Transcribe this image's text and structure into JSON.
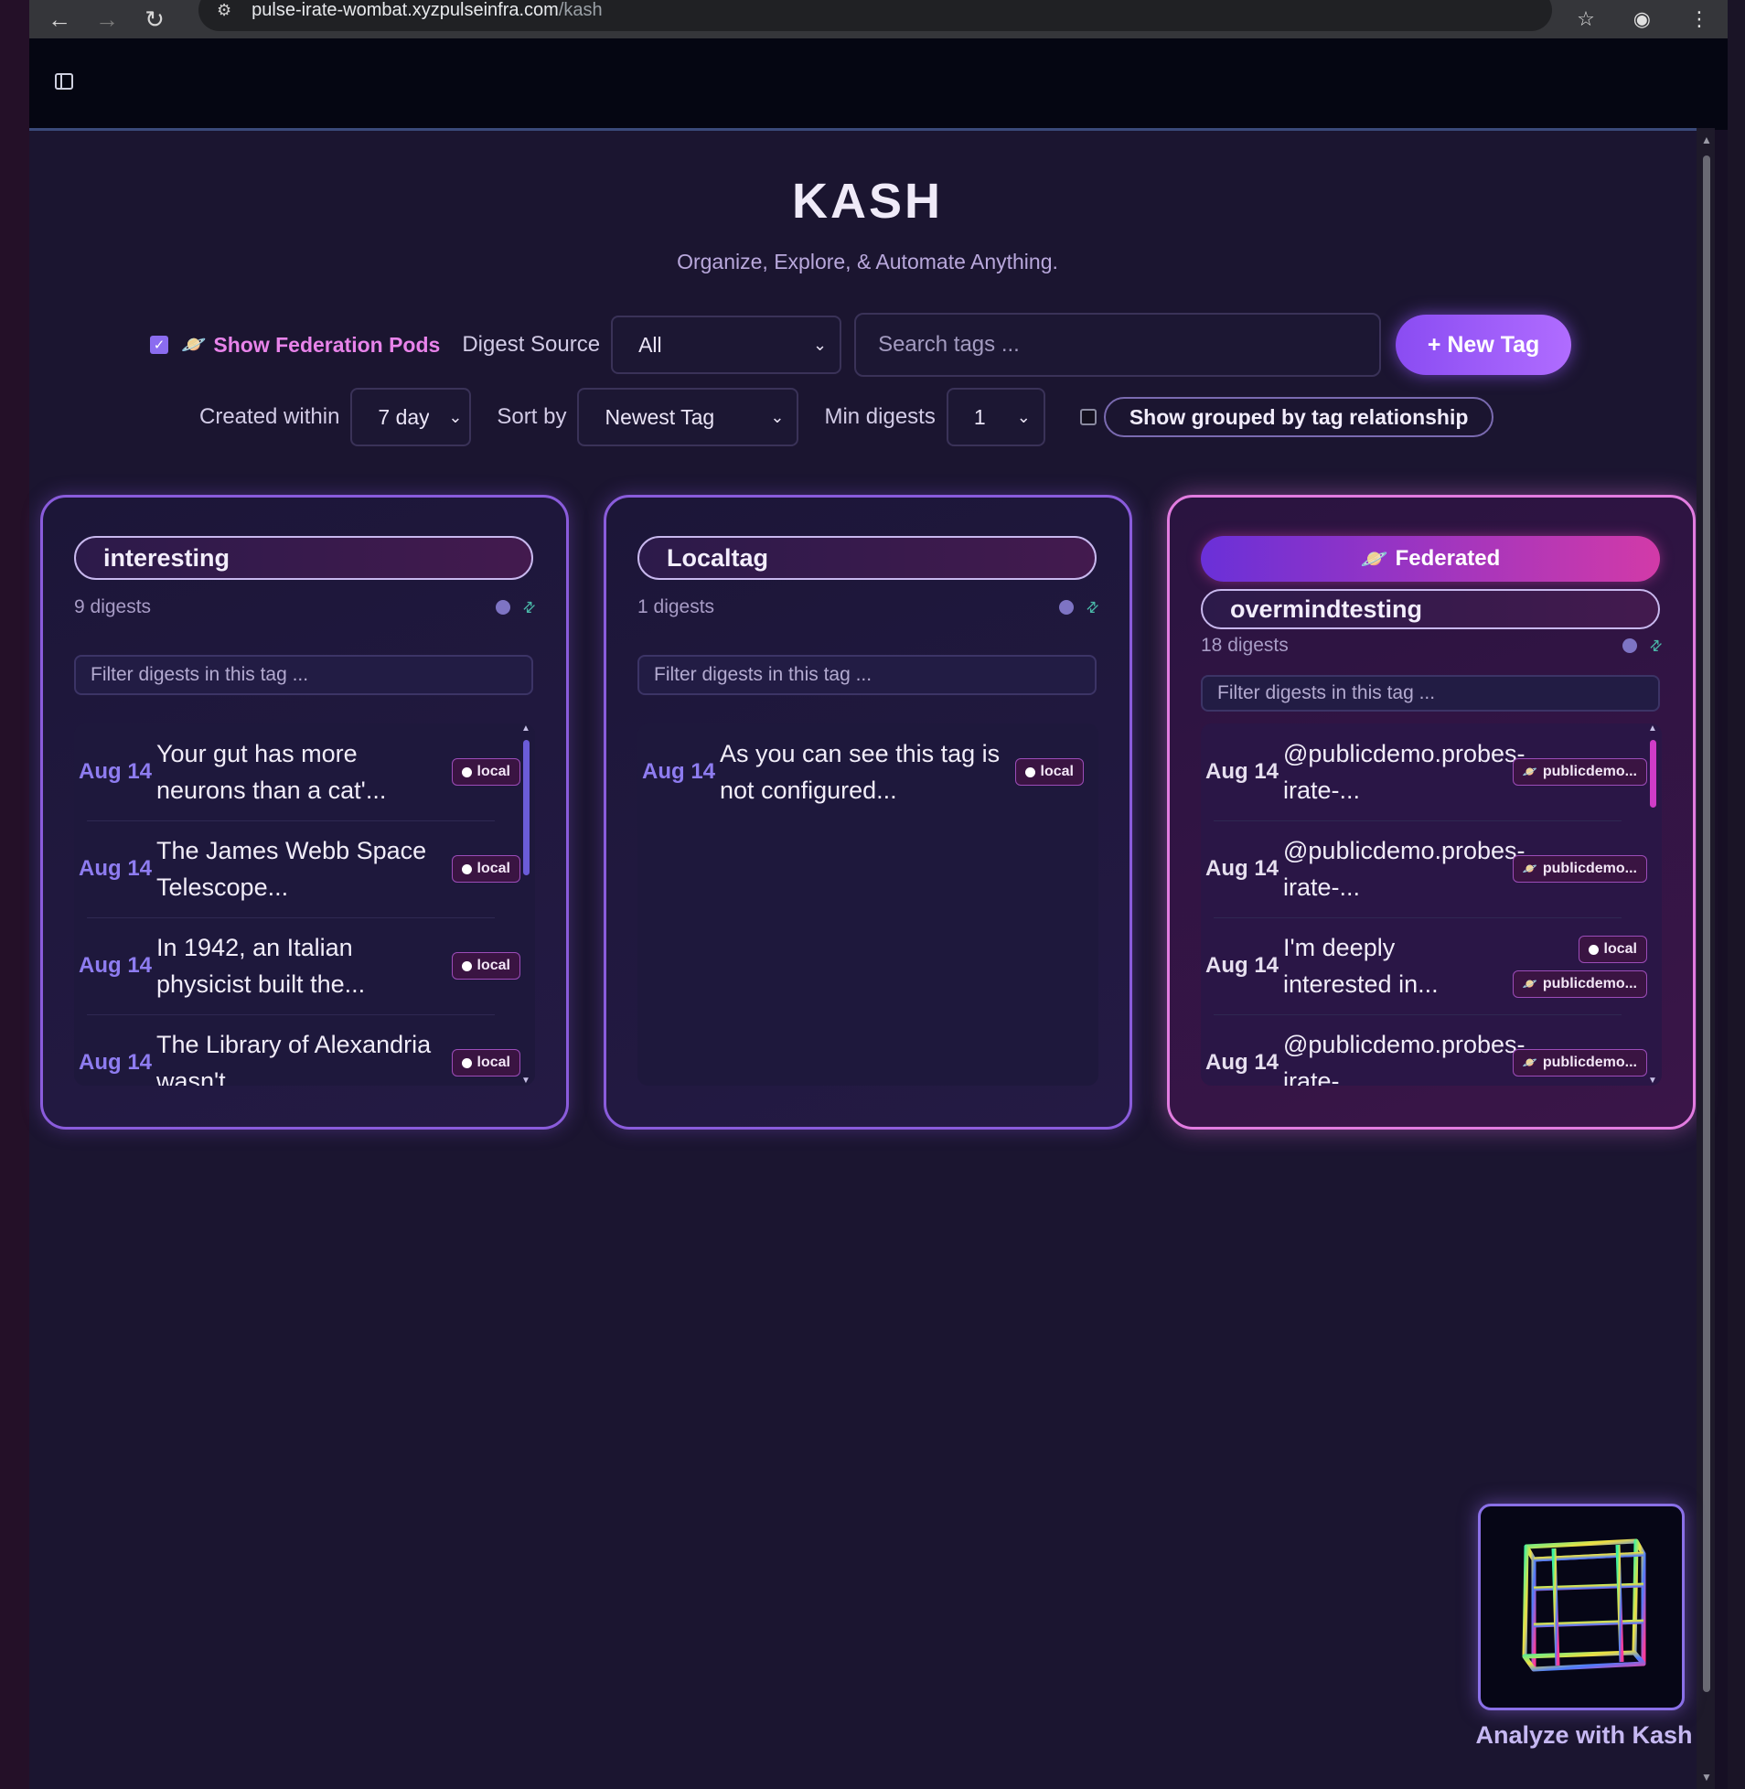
{
  "browser": {
    "url_host": "pulse-irate-wombat.xyzpulseinfra.com",
    "url_path": "/kash"
  },
  "app": {
    "title": "KASH",
    "subtitle": "Organize, Explore, & Automate Anything."
  },
  "controls": {
    "show_federation_label": "Show Federation Pods",
    "show_federation_checked": true,
    "digest_source_label": "Digest Source",
    "digest_source_value": "All",
    "search_placeholder": "Search tags ...",
    "new_tag_label": "+ New Tag",
    "created_within_label": "Created within",
    "created_within_value": "7 day",
    "sort_by_label": "Sort by",
    "sort_by_value": "Newest Tag",
    "min_digests_label": "Min digests",
    "min_digests_value": "1",
    "group_label": "Show grouped by tag relationship",
    "group_checked": false
  },
  "cards": [
    {
      "tag": "interesting",
      "count": "9 digests",
      "filter_placeholder": "Filter digests in this tag ...",
      "items": [
        {
          "date": "Aug 14",
          "text": "Your gut has more neurons than a cat'...",
          "badge": "local"
        },
        {
          "date": "Aug 14",
          "text": "The James Webb Space Telescope...",
          "badge": "local"
        },
        {
          "date": "Aug 14",
          "text": "In 1942, an Italian physicist built the...",
          "badge": "local"
        },
        {
          "date": "Aug 14",
          "text": "The Library of Alexandria wasn't...",
          "badge": "local"
        }
      ]
    },
    {
      "tag": "Localtag",
      "count": "1 digests",
      "filter_placeholder": "Filter digests in this tag ...",
      "items": [
        {
          "date": "Aug 14",
          "text": "As you can see this tag is not configured...",
          "badge": "local"
        }
      ]
    },
    {
      "federated_label": "Federated",
      "tag": "overmindtesting",
      "count": "18 digests",
      "filter_placeholder": "Filter digests in this tag ...",
      "items": [
        {
          "date": "Aug 14",
          "text": "@publicdemo.probes-irate-...",
          "badge": "publicdemo..."
        },
        {
          "date": "Aug 14",
          "text": "@publicdemo.probes-irate-...",
          "badge": "publicdemo..."
        },
        {
          "date": "Aug 14",
          "text": "I'm deeply interested in...",
          "badge": "local",
          "badge2": "publicdemo..."
        },
        {
          "date": "Aug 14",
          "text": "@publicdemo.probes-irate-...",
          "badge": "publicdemo..."
        }
      ]
    }
  ],
  "analyze": {
    "label": "Analyze with Kash"
  },
  "colors": {
    "accent": "#8a4cf2",
    "federation": "#e883ea",
    "card_border": "#8a5cdc",
    "fed_border": "#e27ce0"
  }
}
